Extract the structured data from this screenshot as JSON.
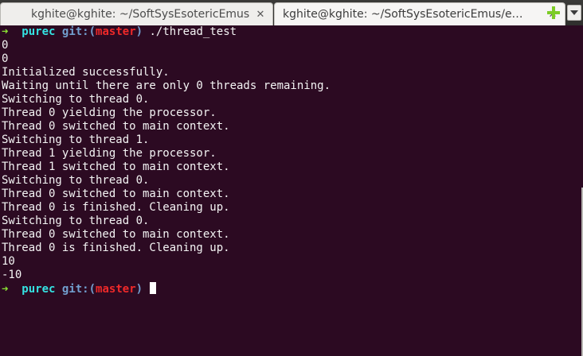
{
  "tabs": [
    {
      "title": "kghite@kghite: ~/SoftSysEsotericEmus",
      "close": "✕"
    },
    {
      "title": "kghite@kghite: ~/SoftSysEsotericEmus/e…",
      "close": "✕"
    }
  ],
  "prompt": {
    "arrow": "➜",
    "dir": "purec",
    "git": "git:",
    "lparen": "(",
    "branch": "master",
    "rparen": ")"
  },
  "command": "./thread_test",
  "output": [
    "0",
    "0",
    "Initialized successfully.",
    "Waiting until there are only 0 threads remaining.",
    "Switching to thread 0.",
    "Thread 0 yielding the processor.",
    "Thread 0 switched to main context.",
    "Switching to thread 1.",
    "Thread 1 yielding the processor.",
    "Thread 1 switched to main context.",
    "Switching to thread 0.",
    "Thread 0 switched to main context.",
    "Thread 0 is finished. Cleaning up.",
    "Switching to thread 0.",
    "Thread 0 switched to main context.",
    "Thread 0 is finished. Cleaning up.",
    "10",
    "-10"
  ],
  "icons": {
    "new_tab": "plus-icon",
    "tab_menu": "chevron-down-icon"
  },
  "colors": {
    "background": "#2c0a22",
    "prompt_arrow": "#8ae234",
    "prompt_dir": "#34e2e2",
    "git_label": "#729fcf",
    "branch": "#ef2929"
  }
}
